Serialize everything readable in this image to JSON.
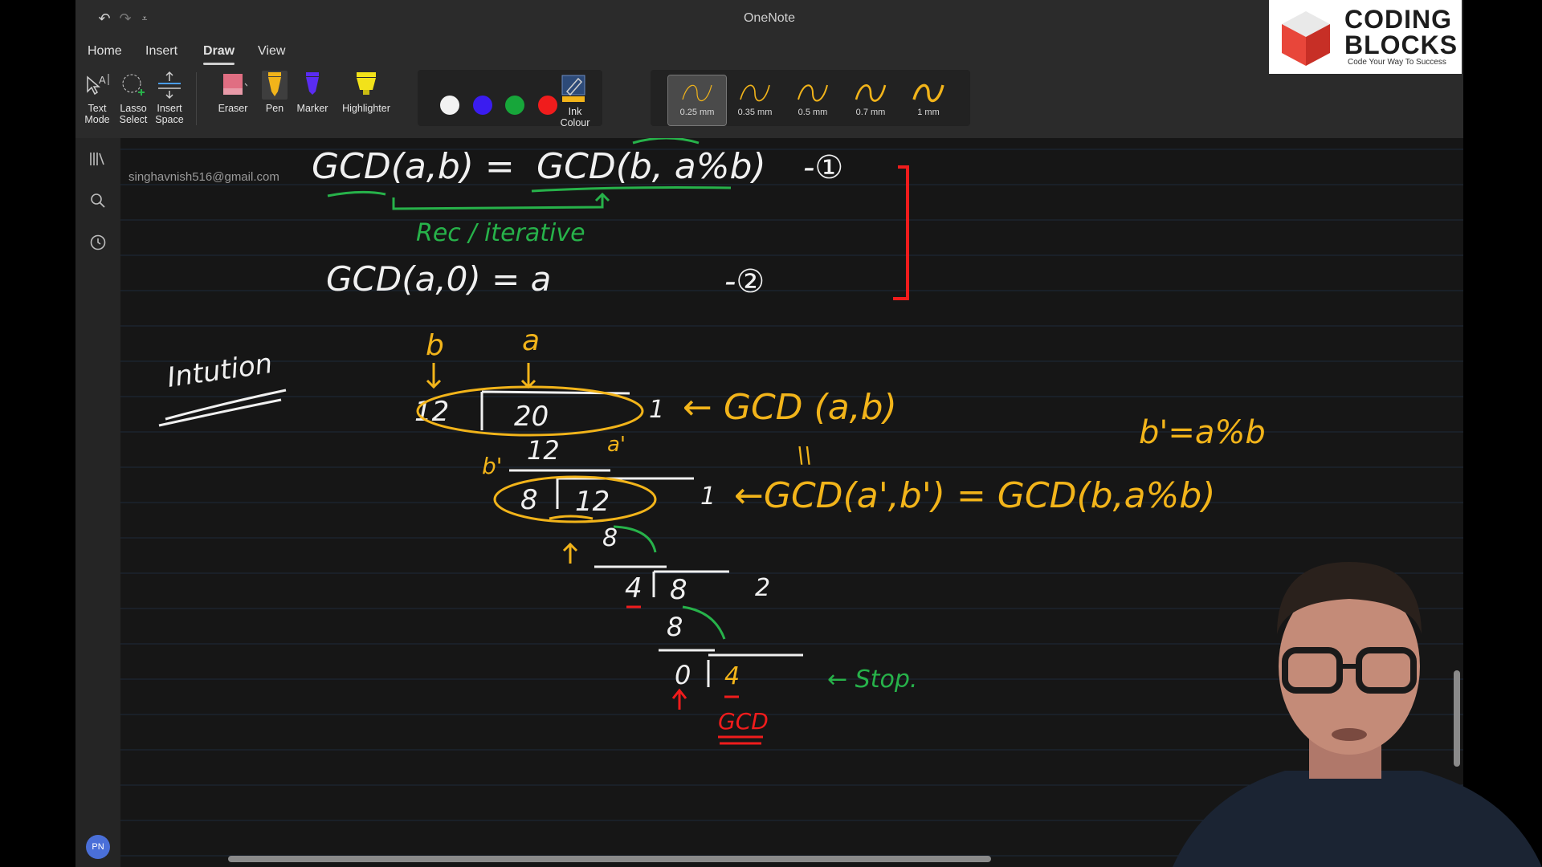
{
  "window": {
    "title": "OneNote"
  },
  "quick_access": {
    "undo": "undo-icon",
    "redo": "redo-icon",
    "customize": "chevron-down-icon"
  },
  "ribbon": {
    "tabs": [
      {
        "label": "Home",
        "active": false
      },
      {
        "label": "Insert",
        "active": false
      },
      {
        "label": "Draw",
        "active": true
      },
      {
        "label": "View",
        "active": false
      }
    ],
    "tools": {
      "text_mode": "Text\nMode",
      "lasso_select": "Lasso\nSelect",
      "insert_space": "Insert\nSpace",
      "eraser": "Eraser",
      "pen": "Pen",
      "marker": "Marker",
      "highlighter": "Highlighter",
      "ink_colour": "Ink\nColour"
    },
    "colors": [
      "#f2f2f2",
      "#3a1cf0",
      "#17a63a",
      "#f01c1c"
    ],
    "pen_sizes": [
      {
        "label": "0.25 mm",
        "selected": true
      },
      {
        "label": "0.35 mm",
        "selected": false
      },
      {
        "label": "0.5 mm",
        "selected": false
      },
      {
        "label": "0.7 mm",
        "selected": false
      },
      {
        "label": "1 mm",
        "selected": false
      }
    ]
  },
  "sidebar": {
    "icons": [
      "notebooks-icon",
      "search-icon",
      "recent-icon"
    ],
    "avatar": "PN"
  },
  "page": {
    "account_email": "singhavnish516@gmail.com"
  },
  "ink": {
    "eq1_left": "GCD(a,b) =",
    "eq1_right": "GCD(b, a%b)",
    "eq1_num": "-①",
    "rec_note": "Rec / iterative",
    "eq2": "GCD(a,0) =  a",
    "eq2_num": "-②",
    "intuition": "Intution",
    "label_b": "b",
    "label_a": "a",
    "d1_divisor": "12",
    "d1_dividend": "20",
    "d1_quotient": "1",
    "d1_product": "12",
    "d1_note": "← GCD (a,b)",
    "bprime_def": "b'=a%b",
    "label_bprime": "b'",
    "label_aprime": "a'",
    "equals_marks": "\\\\",
    "d2_divisor": "8",
    "d2_dividend": "12",
    "d2_quotient": "1",
    "d2_product": "8",
    "d2_note": "←GCD(a',b') = GCD(b,a%b)",
    "d3_divisor": "4",
    "d3_dividend": "8",
    "d3_quotient": "2",
    "d3_product": "8",
    "d4_divisor": "0",
    "d4_dividend": "4",
    "stop_note": "← Stop.",
    "gcd_label": "GCD"
  },
  "branding": {
    "logo_line1": "CODING",
    "logo_line2": "BLOCKS",
    "logo_tagline": "Code Your Way To Success"
  },
  "colors": {
    "ink_white": "#f0f0f0",
    "ink_yellow": "#f2b41a",
    "ink_green": "#27b24a",
    "ink_red": "#f01c1c",
    "canvas_bg": "#161616",
    "rule_line": "#1f2a3a"
  }
}
